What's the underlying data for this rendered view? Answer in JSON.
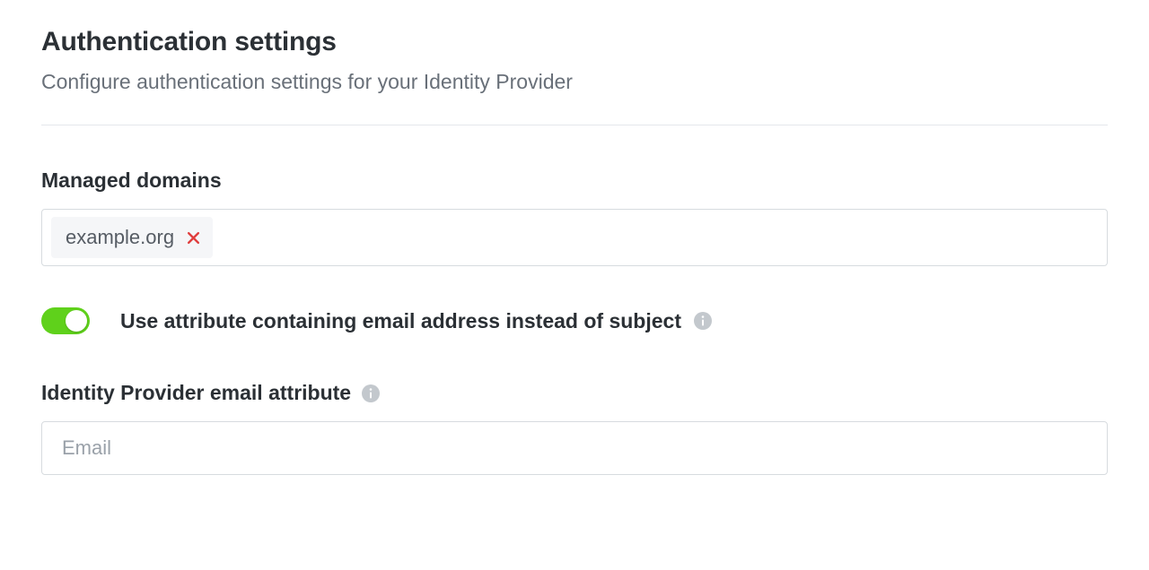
{
  "header": {
    "title": "Authentication settings",
    "subtitle": "Configure authentication settings for your Identity Provider"
  },
  "managed_domains": {
    "label": "Managed domains",
    "tags": [
      "example.org"
    ]
  },
  "use_attribute": {
    "label": "Use attribute containing email address instead of subject",
    "enabled": true
  },
  "email_attribute": {
    "label": "Identity Provider email attribute",
    "placeholder": "Email",
    "value": ""
  }
}
